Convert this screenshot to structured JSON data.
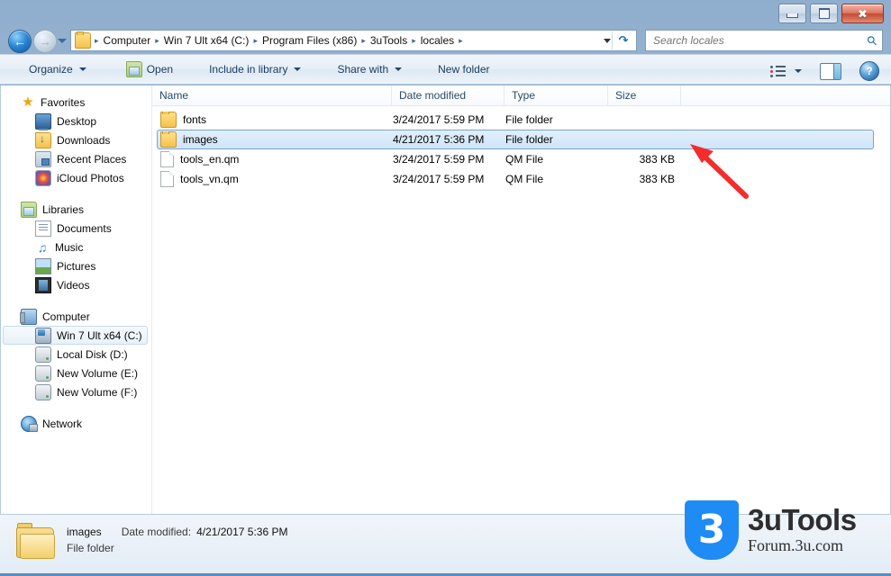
{
  "window": {
    "controls": {
      "minimize": "Minimize",
      "maximize": "Maximize",
      "close": "Close"
    }
  },
  "address": {
    "back": "Back",
    "forward": "Forward",
    "recent_pages": "Recent pages",
    "breadcrumbs": [
      "Computer",
      "Win 7 Ult x64 (C:)",
      "Program Files (x86)",
      "3uTools",
      "locales"
    ],
    "separator": "▸",
    "refresh": "Refresh",
    "folder_icon": "folder-icon"
  },
  "search": {
    "placeholder": "Search locales",
    "value": "",
    "icon": "search-icon"
  },
  "toolbar": {
    "organize": "Organize",
    "open": "Open",
    "include_in_library": "Include in library",
    "share_with": "Share with",
    "new_folder": "New folder",
    "change_view": "change-view-icon",
    "preview_pane": "preview-pane-icon",
    "help": "help-icon"
  },
  "sidebar": {
    "sections": [
      {
        "group": "Favorites",
        "group_icon": "star-icon",
        "items": [
          {
            "label": "Desktop",
            "icon": "desktop-icon",
            "selected": false
          },
          {
            "label": "Downloads",
            "icon": "downloads-icon",
            "selected": false
          },
          {
            "label": "Recent Places",
            "icon": "recent-places-icon",
            "selected": false
          },
          {
            "label": "iCloud Photos",
            "icon": "icloud-photos-icon",
            "selected": false
          }
        ]
      },
      {
        "group": "Libraries",
        "group_icon": "libraries-icon",
        "items": [
          {
            "label": "Documents",
            "icon": "documents-icon",
            "selected": false
          },
          {
            "label": "Music",
            "icon": "music-icon",
            "selected": false
          },
          {
            "label": "Pictures",
            "icon": "pictures-icon",
            "selected": false
          },
          {
            "label": "Videos",
            "icon": "videos-icon",
            "selected": false
          }
        ]
      },
      {
        "group": "Computer",
        "group_icon": "computer-icon",
        "items": [
          {
            "label": "Win 7 Ult x64 (C:)",
            "icon": "os-drive-icon",
            "selected": true
          },
          {
            "label": "Local Disk (D:)",
            "icon": "drive-icon",
            "selected": false
          },
          {
            "label": "New Volume (E:)",
            "icon": "drive-icon",
            "selected": false
          },
          {
            "label": "New Volume (F:)",
            "icon": "drive-icon",
            "selected": false
          }
        ]
      },
      {
        "group": "Network",
        "group_icon": "network-icon",
        "items": []
      }
    ]
  },
  "file_list": {
    "columns": [
      "Name",
      "Date modified",
      "Type",
      "Size"
    ],
    "rows": [
      {
        "name": "fonts",
        "date": "3/24/2017 5:59 PM",
        "type": "File folder",
        "size": "",
        "icon": "folder-icon",
        "selected": false
      },
      {
        "name": "images",
        "date": "4/21/2017 5:36 PM",
        "type": "File folder",
        "size": "",
        "icon": "folder-icon",
        "selected": true
      },
      {
        "name": "tools_en.qm",
        "date": "3/24/2017 5:59 PM",
        "type": "QM File",
        "size": "383 KB",
        "icon": "file-icon",
        "selected": false
      },
      {
        "name": "tools_vn.qm",
        "date": "3/24/2017 5:59 PM",
        "type": "QM File",
        "size": "383 KB",
        "icon": "file-icon",
        "selected": false
      }
    ]
  },
  "annotation": {
    "arrow_color": "#f42c2c",
    "name": "red-arrow-pointer"
  },
  "status_bar": {
    "item_name": "images",
    "date_label": "Date modified:",
    "date_value": "4/21/2017 5:36 PM",
    "item_type": "File folder",
    "icon": "folder-icon"
  },
  "watermark": {
    "logo_char": "3",
    "title": "3uTools",
    "subtitle": "Forum.3u.com",
    "brand_color": "#1f8bf5"
  }
}
